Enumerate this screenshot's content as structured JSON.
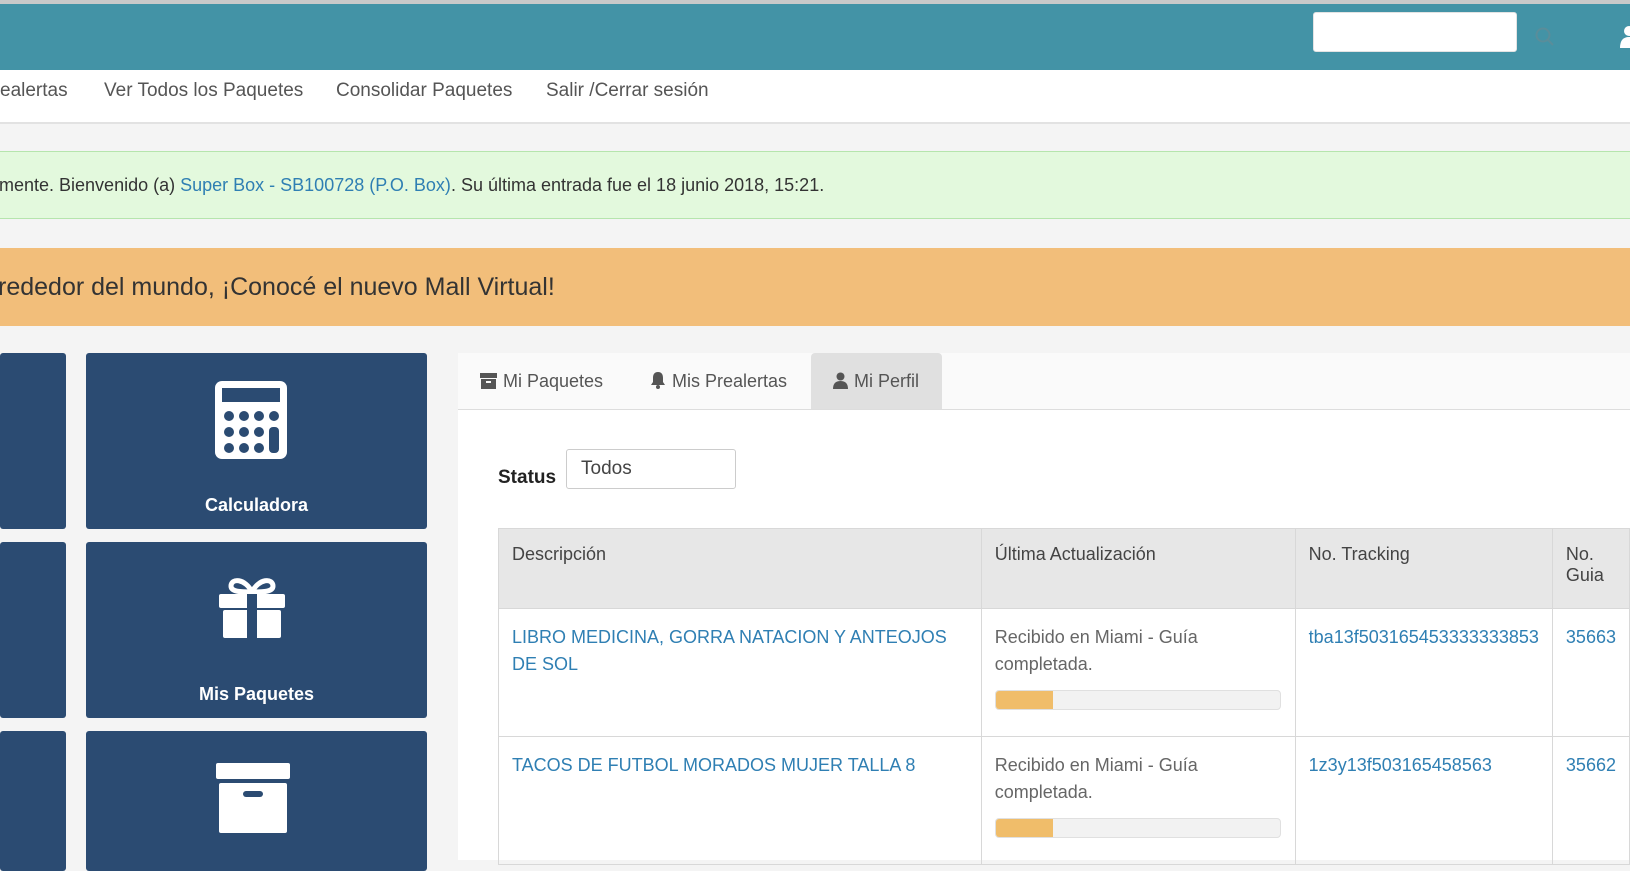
{
  "header": {
    "search": {
      "value": "",
      "placeholder": ""
    },
    "colors": {
      "primary": "#4393a6",
      "tile": "#2b4b72",
      "promo": "#f2be7a",
      "success_bg": "#e3f9dd",
      "link": "#2f7fb3"
    }
  },
  "nav": {
    "items": [
      "ealertas",
      "Ver Todos los Paquetes",
      "Consolidar Paquetes",
      "Salir /Cerrar sesión"
    ]
  },
  "alert": {
    "prefix": "mente. Bienvenido (a) ",
    "account_link": "Super Box - SB100728 (P.O. Box)",
    "suffix": ". Su última entrada fue el 18 junio 2018, 15:21."
  },
  "promo": {
    "text": "rededor del mundo, ¡Conocé el nuevo Mall Virtual!"
  },
  "tiles": [
    {
      "label": "Calculadora",
      "icon": "calculator-icon"
    },
    {
      "label": "Mis Paquetes",
      "icon": "gift-icon"
    },
    {
      "label": "",
      "icon": "archive-box-icon"
    }
  ],
  "tabs": [
    {
      "label": "Mi Paquetes",
      "icon": "archive-icon",
      "active": false
    },
    {
      "label": "Mis Prealertas",
      "icon": "bell-icon",
      "active": false
    },
    {
      "label": "Mi Perfil",
      "icon": "user-icon",
      "active": true
    }
  ],
  "filter": {
    "label": "Status",
    "value": "Todos"
  },
  "table": {
    "headers": [
      "Descripción",
      "Última Actualización",
      "No. Tracking",
      "No. Guia"
    ],
    "rows": [
      {
        "description": "LIBRO MEDICINA, GORRA NATACION Y ANTEOJOS DE SOL",
        "status": "Recibido en Miami - Guía completada.",
        "progress": 0.2,
        "tracking": "tba13f503165453333333853",
        "guia": "35663"
      },
      {
        "description": "TACOS DE FUTBOL MORADOS MUJER TALLA 8",
        "status": "Recibido en Miami - Guía completada.",
        "progress": 0.2,
        "tracking": "1z3y13f503165458563",
        "guia": "35662"
      }
    ]
  }
}
